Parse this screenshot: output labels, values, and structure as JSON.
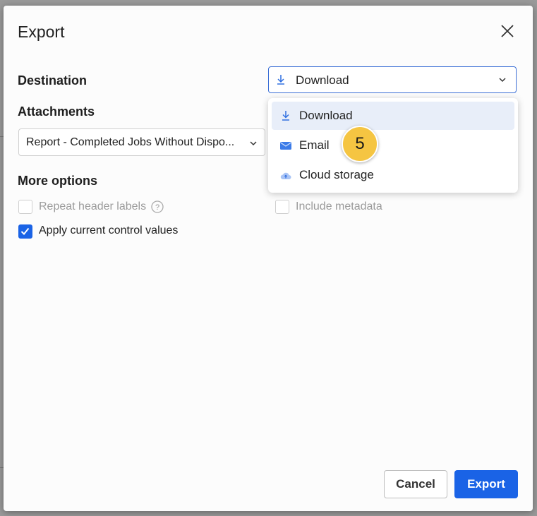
{
  "dialog": {
    "title": "Export",
    "destination_label": "Destination",
    "destination_value": "Download",
    "attachments_label": "Attachments",
    "attachment_value": "Report - Completed Jobs Without Dispo...",
    "more_options_label": "More options",
    "options": [
      {
        "label": "Repeat header labels",
        "checked": false,
        "disabled": true
      },
      {
        "label": "Include metadata",
        "checked": false,
        "disabled": true
      },
      {
        "label": "Apply current control values",
        "checked": true,
        "disabled": false
      }
    ],
    "cancel_label": "Cancel",
    "export_label": "Export"
  },
  "menu": {
    "items": [
      {
        "label": "Download",
        "icon": "download-icon",
        "active": true
      },
      {
        "label": "Email",
        "icon": "email-icon",
        "active": false
      },
      {
        "label": "Cloud storage",
        "icon": "cloud-upload-icon",
        "active": false
      }
    ]
  },
  "badge": {
    "number": "5"
  },
  "colors": {
    "accent": "#1a63e6",
    "badge": "#f5c542",
    "active_item": "#e8eef9"
  }
}
